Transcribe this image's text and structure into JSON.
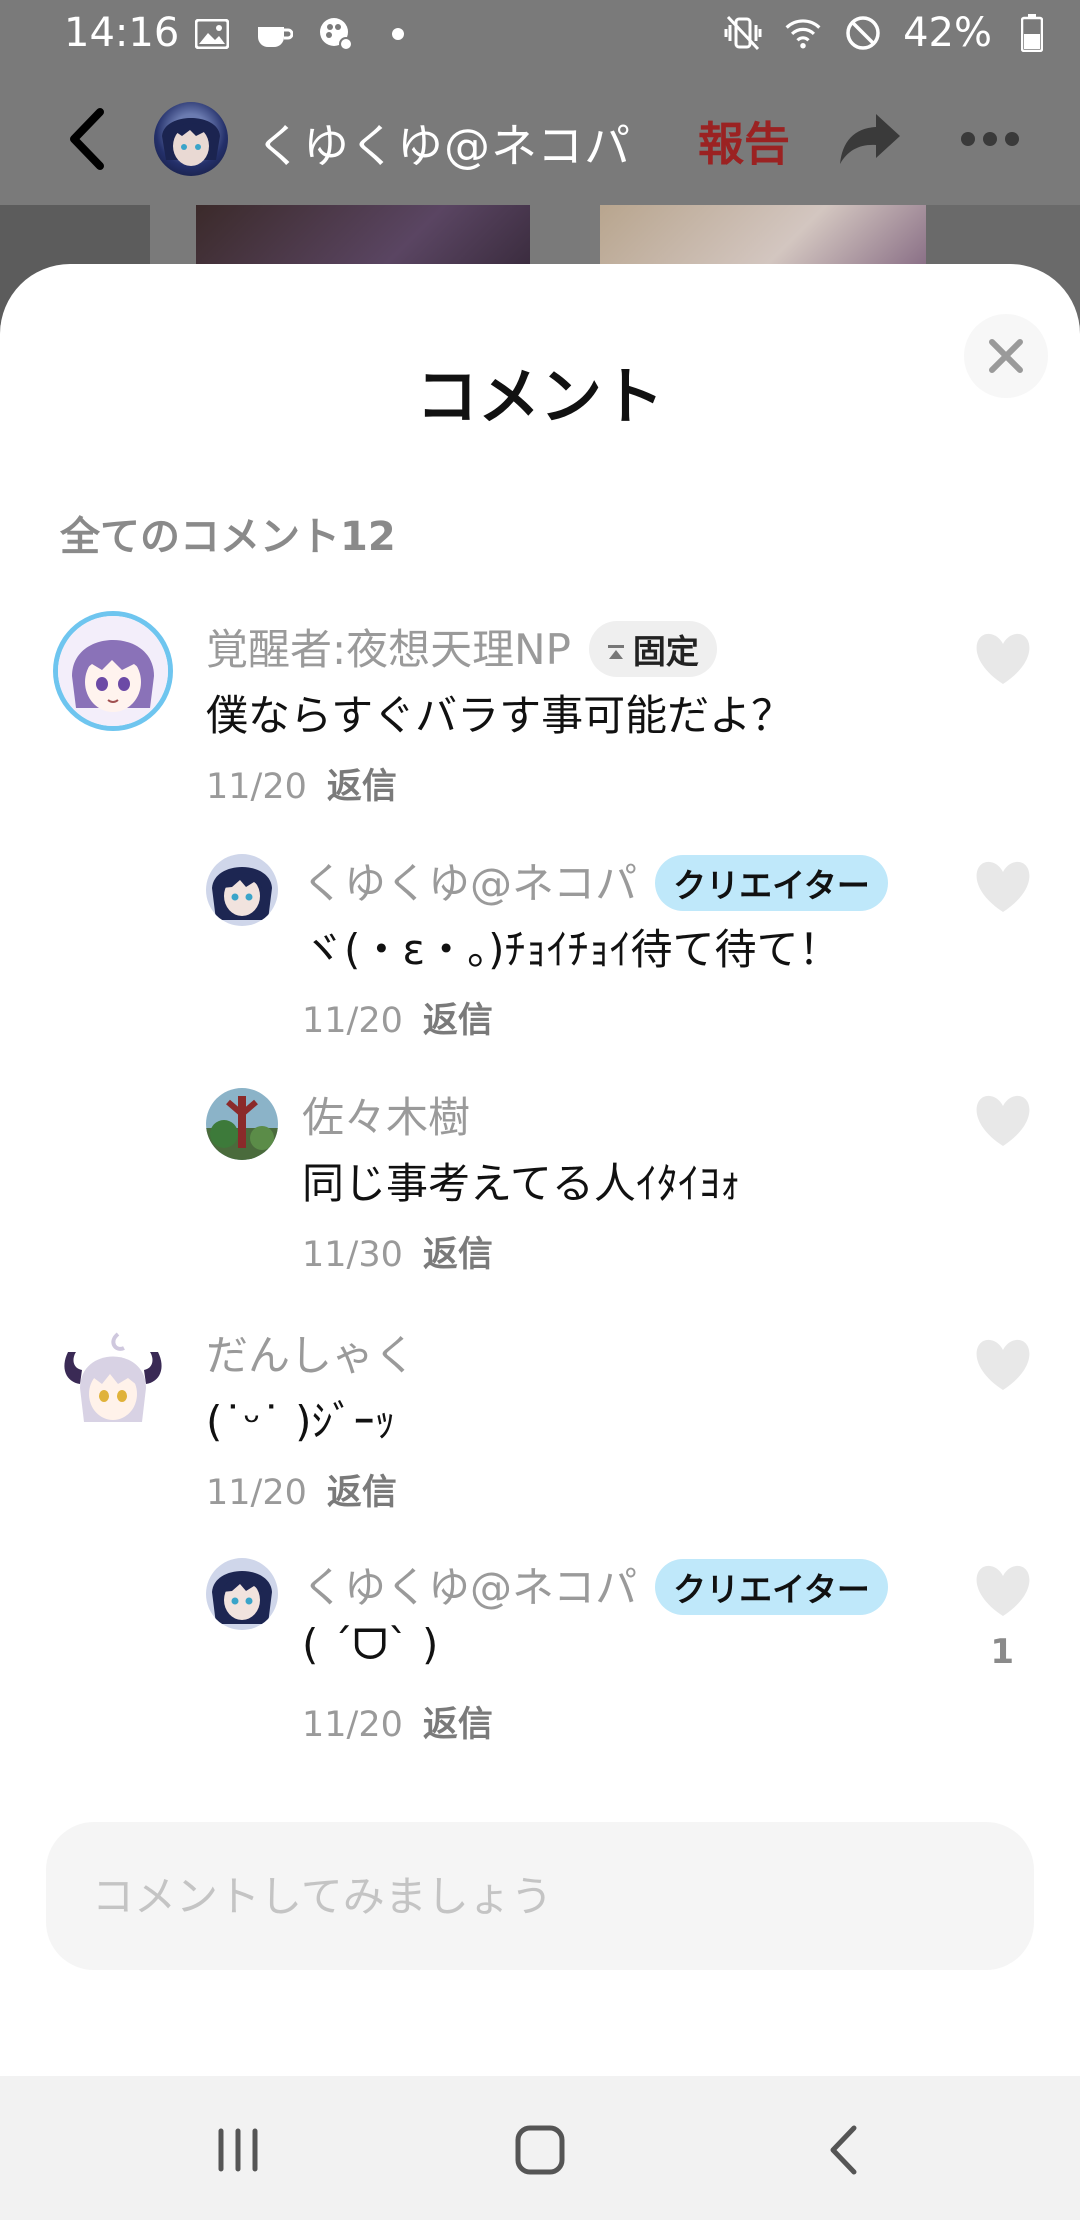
{
  "status_bar": {
    "time": "14:16",
    "battery": "42%",
    "icons_left": [
      "image-icon",
      "cup-icon",
      "paint-icon",
      "dot-icon"
    ],
    "icons_right": [
      "mute-vibrate-icon",
      "wifi-icon",
      "block-icon",
      "battery-icon"
    ]
  },
  "header": {
    "user_name": "くゆくゆ@ネコパ",
    "report_label": "報告",
    "report_color": "#9b2222"
  },
  "sheet": {
    "title": "コメント",
    "count_label": "全てのコメント12"
  },
  "comments": [
    {
      "name": "覚醒者:夜想天理NP",
      "badge": "固定",
      "text": "僕ならすぐバラす事可能だよ？",
      "date": "11/20",
      "reply": "返信"
    },
    {
      "name": "くゆくゆ@ネコパ",
      "badge": "クリエイター",
      "text": "ヾ(・ε・。)ﾁｮｲﾁｮｲ待て待て！",
      "date": "11/20",
      "reply": "返信"
    },
    {
      "name": "佐々木樹",
      "text": "同じ事考えてる人ｲﾀｲﾖｫ",
      "date": "11/30",
      "reply": "返信"
    },
    {
      "name": "だんしゃく",
      "text": "(˙ᵕ˙ )ｼﾞｰｯ",
      "date": "11/20",
      "reply": "返信"
    },
    {
      "name": "くゆくゆ@ネコパ",
      "badge": "クリエイター",
      "text": "( ˊᗜˋ )",
      "date": "11/20",
      "reply": "返信",
      "likes": "1"
    }
  ],
  "input": {
    "placeholder": "コメントしてみましょう"
  },
  "colors": {
    "creator_badge_bg": "#bfe8fa",
    "pin_badge_bg": "#efefef",
    "scrim": "#7a7a7a"
  }
}
